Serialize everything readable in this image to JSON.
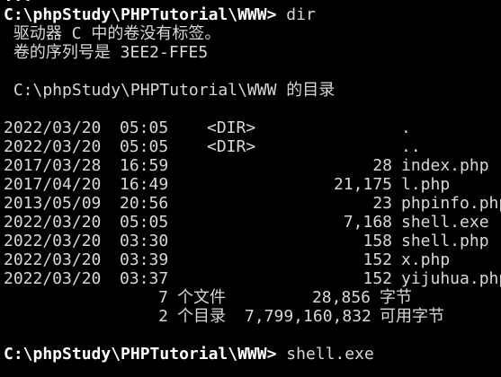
{
  "console": {
    "top_prompt": {
      "path": "C:\\phpStudy\\PHPTutorial\\WWW>",
      "command": "dir"
    },
    "volume_line_1": " 驱动器 C 中的卷没有标签。",
    "volume_line_2": " 卷的序列号是 3EE2-FFE5",
    "dir_of_line": " C:\\phpStudy\\PHPTutorial\\WWW 的目录",
    "entries": [
      {
        "date": "2022/03/20",
        "time": "05:05",
        "dir": "<DIR>",
        "size": "",
        "name": "."
      },
      {
        "date": "2022/03/20",
        "time": "05:05",
        "dir": "<DIR>",
        "size": "",
        "name": ".."
      },
      {
        "date": "2017/03/28",
        "time": "16:59",
        "dir": "",
        "size": "28",
        "name": "index.php"
      },
      {
        "date": "2017/04/20",
        "time": "16:49",
        "dir": "",
        "size": "21,175",
        "name": "l.php"
      },
      {
        "date": "2013/05/09",
        "time": "20:56",
        "dir": "",
        "size": "23",
        "name": "phpinfo.php"
      },
      {
        "date": "2022/03/20",
        "time": "05:05",
        "dir": "",
        "size": "7,168",
        "name": "shell.exe"
      },
      {
        "date": "2022/03/20",
        "time": "03:30",
        "dir": "",
        "size": "158",
        "name": "shell.php"
      },
      {
        "date": "2022/03/20",
        "time": "03:39",
        "dir": "",
        "size": "152",
        "name": "x.php"
      },
      {
        "date": "2022/03/20",
        "time": "03:37",
        "dir": "",
        "size": "152",
        "name": "yijuhua.php"
      }
    ],
    "summary_files": {
      "count": "7",
      "label": "个文件",
      "size": "28,856",
      "suffix": "字节"
    },
    "summary_dirs": {
      "count": "2",
      "label": "个目录",
      "size": "7,799,160,832",
      "suffix": "可用字节"
    },
    "bottom_prompt": {
      "path": "C:\\phpStudy\\PHPTutorial\\WWW>",
      "command": "shell.exe"
    }
  }
}
